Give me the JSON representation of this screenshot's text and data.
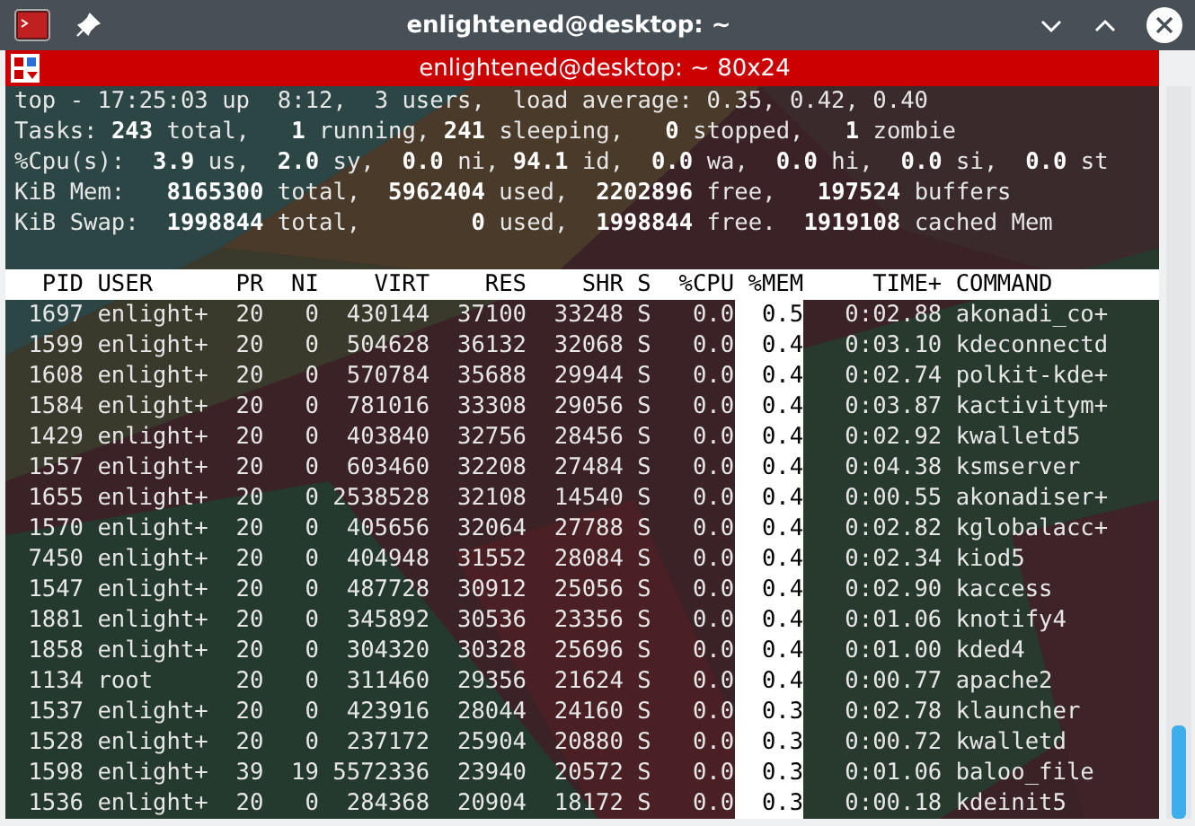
{
  "window": {
    "title": "enlightened@desktop: ~"
  },
  "tab": {
    "title": "enlightened@desktop: ~ 80x24"
  },
  "summary": [
    "top - 17:25:03 up  8:12,  3 users,  load average: 0.35, 0.42, 0.40",
    "Tasks: **243** total,   **1** running, **241** sleeping,   **0** stopped,   **1** zombie",
    "%Cpu(s):  **3.9** us,  **2.0** sy,  **0.0** ni, **94.1** id,  **0.0** wa,  **0.0** hi,  **0.0** si,  **0.0** st",
    "KiB Mem:   **8165300** total,  **5962404** used,  **2202896** free,   **197524** buffers",
    "KiB Swap:  **1998844** total,        **0** used,  **1998844** free.  **1919108** cached Mem"
  ],
  "table": {
    "columns": [
      {
        "label": "PID",
        "selected": false
      },
      {
        "label": "USER",
        "selected": false
      },
      {
        "label": "PR",
        "selected": false
      },
      {
        "label": "NI",
        "selected": false
      },
      {
        "label": "VIRT",
        "selected": false
      },
      {
        "label": "RES",
        "selected": false
      },
      {
        "label": "SHR",
        "selected": false
      },
      {
        "label": "S",
        "selected": false
      },
      {
        "label": "%CPU",
        "selected": false
      },
      {
        "label": "%MEM",
        "selected": true
      },
      {
        "label": "TIME+",
        "selected": false
      },
      {
        "label": "COMMAND",
        "selected": false
      }
    ],
    "rows": [
      [
        "1697",
        "enlight+",
        "20",
        "0",
        "430144",
        "37100",
        "33248",
        "S",
        "0.0",
        "0.5",
        "0:02.88",
        "akonadi_co+"
      ],
      [
        "1599",
        "enlight+",
        "20",
        "0",
        "504628",
        "36132",
        "32068",
        "S",
        "0.0",
        "0.4",
        "0:03.10",
        "kdeconnectd"
      ],
      [
        "1608",
        "enlight+",
        "20",
        "0",
        "570784",
        "35688",
        "29944",
        "S",
        "0.0",
        "0.4",
        "0:02.74",
        "polkit-kde+"
      ],
      [
        "1584",
        "enlight+",
        "20",
        "0",
        "781016",
        "33308",
        "29056",
        "S",
        "0.0",
        "0.4",
        "0:03.87",
        "kactivitym+"
      ],
      [
        "1429",
        "enlight+",
        "20",
        "0",
        "403840",
        "32756",
        "28456",
        "S",
        "0.0",
        "0.4",
        "0:02.92",
        "kwalletd5"
      ],
      [
        "1557",
        "enlight+",
        "20",
        "0",
        "603460",
        "32208",
        "27484",
        "S",
        "0.0",
        "0.4",
        "0:04.38",
        "ksmserver"
      ],
      [
        "1655",
        "enlight+",
        "20",
        "0",
        "2538528",
        "32108",
        "14540",
        "S",
        "0.0",
        "0.4",
        "0:00.55",
        "akonadiser+"
      ],
      [
        "1570",
        "enlight+",
        "20",
        "0",
        "405656",
        "32064",
        "27788",
        "S",
        "0.0",
        "0.4",
        "0:02.82",
        "kglobalacc+"
      ],
      [
        "7450",
        "enlight+",
        "20",
        "0",
        "404948",
        "31552",
        "28084",
        "S",
        "0.0",
        "0.4",
        "0:02.34",
        "kiod5"
      ],
      [
        "1547",
        "enlight+",
        "20",
        "0",
        "487728",
        "30912",
        "25056",
        "S",
        "0.0",
        "0.4",
        "0:02.90",
        "kaccess"
      ],
      [
        "1881",
        "enlight+",
        "20",
        "0",
        "345892",
        "30536",
        "23356",
        "S",
        "0.0",
        "0.4",
        "0:01.06",
        "knotify4"
      ],
      [
        "1858",
        "enlight+",
        "20",
        "0",
        "304320",
        "30328",
        "25696",
        "S",
        "0.0",
        "0.4",
        "0:01.00",
        "kded4"
      ],
      [
        "1134",
        "root",
        "20",
        "0",
        "311460",
        "29356",
        "21624",
        "S",
        "0.0",
        "0.4",
        "0:00.77",
        "apache2"
      ],
      [
        "1537",
        "enlight+",
        "20",
        "0",
        "423916",
        "28044",
        "24160",
        "S",
        "0.0",
        "0.3",
        "0:02.78",
        "klauncher"
      ],
      [
        "1528",
        "enlight+",
        "20",
        "0",
        "237172",
        "25904",
        "20880",
        "S",
        "0.0",
        "0.3",
        "0:00.72",
        "kwalletd"
      ],
      [
        "1598",
        "enlight+",
        "39",
        "19",
        "5572336",
        "23940",
        "20572",
        "S",
        "0.0",
        "0.3",
        "0:01.06",
        "baloo_file"
      ],
      [
        "1536",
        "enlight+",
        "20",
        "0",
        "284368",
        "20904",
        "18172",
        "S",
        "0.0",
        "0.3",
        "0:00.18",
        "kdeinit5"
      ]
    ]
  }
}
